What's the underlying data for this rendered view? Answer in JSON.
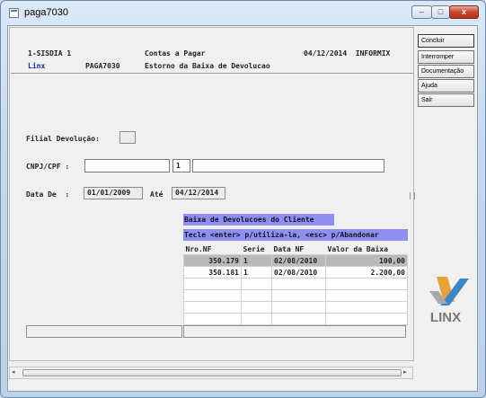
{
  "window": {
    "title": "paga7030",
    "controls": {
      "minimize": "–",
      "maximize": "□",
      "close": "x"
    }
  },
  "header": {
    "system": "1-SISDIA 1",
    "module": "Contas a Pagar",
    "date_vendor": "04/12/2014  INFORMIX",
    "company": "Linx",
    "program": "PAGA7030",
    "description": "Estorno da Baixa de Devolucao"
  },
  "form": {
    "filial_label": "Filial Devolução:",
    "filial_value": "",
    "cnpj_label": "CNPJ/CPF :",
    "cnpj_value": "",
    "cnpj_digit": "1",
    "cnpj_name": "",
    "date_from_label": "Data De  :",
    "date_from": "01/01/2009",
    "date_to_label": "Até",
    "date_to": "04/12/2014"
  },
  "lookup": {
    "title": "Baixa de Devolucoes do Cliente",
    "hint": "Tecle <enter> p/utiliza-la, <esc> p/Abandonar",
    "columns": [
      "Nro.NF",
      "Serie",
      "Data NF",
      "Valor da Baixa"
    ],
    "rows": [
      {
        "nf": "350.179",
        "serie": "1",
        "data": "02/08/2010",
        "valor": "100,00"
      },
      {
        "nf": "350.181",
        "serie": "1",
        "data": "02/08/2010",
        "valor": "2.200,00"
      },
      {
        "nf": "",
        "serie": "",
        "data": "",
        "valor": ""
      },
      {
        "nf": "",
        "serie": "",
        "data": "",
        "valor": ""
      },
      {
        "nf": "",
        "serie": "",
        "data": "",
        "valor": ""
      },
      {
        "nf": "",
        "serie": "",
        "data": "",
        "valor": ""
      }
    ]
  },
  "sidebar": {
    "buttons": [
      "Concluir",
      "Interromper",
      "Documentação",
      "Ajuda",
      "Sair"
    ]
  },
  "logo": {
    "text": "LINX",
    "colors": [
      "#e9a13b",
      "#3a86c8",
      "#6f6f6f"
    ]
  }
}
